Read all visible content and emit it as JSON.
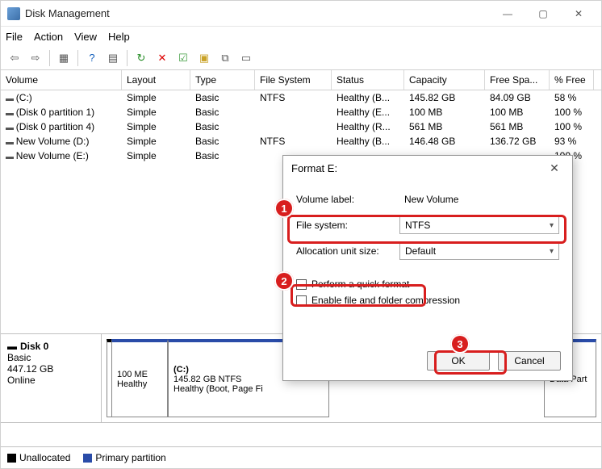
{
  "window": {
    "title": "Disk Management"
  },
  "menu": {
    "file": "File",
    "action": "Action",
    "view": "View",
    "help": "Help"
  },
  "columns": {
    "volume": "Volume",
    "layout": "Layout",
    "type": "Type",
    "filesystem": "File System",
    "status": "Status",
    "capacity": "Capacity",
    "freespace": "Free Spa...",
    "pctfree": "% Free"
  },
  "volumes": [
    {
      "name": "(C:)",
      "layout": "Simple",
      "type": "Basic",
      "fs": "NTFS",
      "status": "Healthy (B...",
      "capacity": "145.82 GB",
      "free": "84.09 GB",
      "pct": "58 %"
    },
    {
      "name": "(Disk 0 partition 1)",
      "layout": "Simple",
      "type": "Basic",
      "fs": "",
      "status": "Healthy (E...",
      "capacity": "100 MB",
      "free": "100 MB",
      "pct": "100 %"
    },
    {
      "name": "(Disk 0 partition 4)",
      "layout": "Simple",
      "type": "Basic",
      "fs": "",
      "status": "Healthy (R...",
      "capacity": "561 MB",
      "free": "561 MB",
      "pct": "100 %"
    },
    {
      "name": "New Volume (D:)",
      "layout": "Simple",
      "type": "Basic",
      "fs": "NTFS",
      "status": "Healthy (B...",
      "capacity": "146.48 GB",
      "free": "136.72 GB",
      "pct": "93 %"
    },
    {
      "name": "New Volume (E:)",
      "layout": "Simple",
      "type": "Basic",
      "fs": "",
      "status": "",
      "capacity": "",
      "free": "",
      "pct": "100 %"
    }
  ],
  "disk": {
    "name": "Disk 0",
    "type": "Basic",
    "size": "447.12 GB",
    "status": "Online",
    "parts": [
      {
        "label1": "100 ME",
        "label2": "Healthy"
      },
      {
        "label0": "(C:)",
        "label1": "145.82 GB NTFS",
        "label2": "Healthy (Boot, Page Fi"
      },
      {
        "label1": "",
        "label2": "Data Part"
      }
    ]
  },
  "legend": {
    "unalloc": "Unallocated",
    "primary": "Primary partition"
  },
  "dialog": {
    "title": "Format E:",
    "labels": {
      "volume_label": "Volume label:",
      "file_system": "File system:",
      "alloc": "Allocation unit size:"
    },
    "values": {
      "volume_label": "New Volume",
      "file_system": "NTFS",
      "alloc": "Default"
    },
    "checks": {
      "quick": "Perform a quick format",
      "compress": "Enable file and folder compression"
    },
    "buttons": {
      "ok": "OK",
      "cancel": "Cancel"
    }
  },
  "annotations": {
    "b1": "1",
    "b2": "2",
    "b3": "3"
  }
}
